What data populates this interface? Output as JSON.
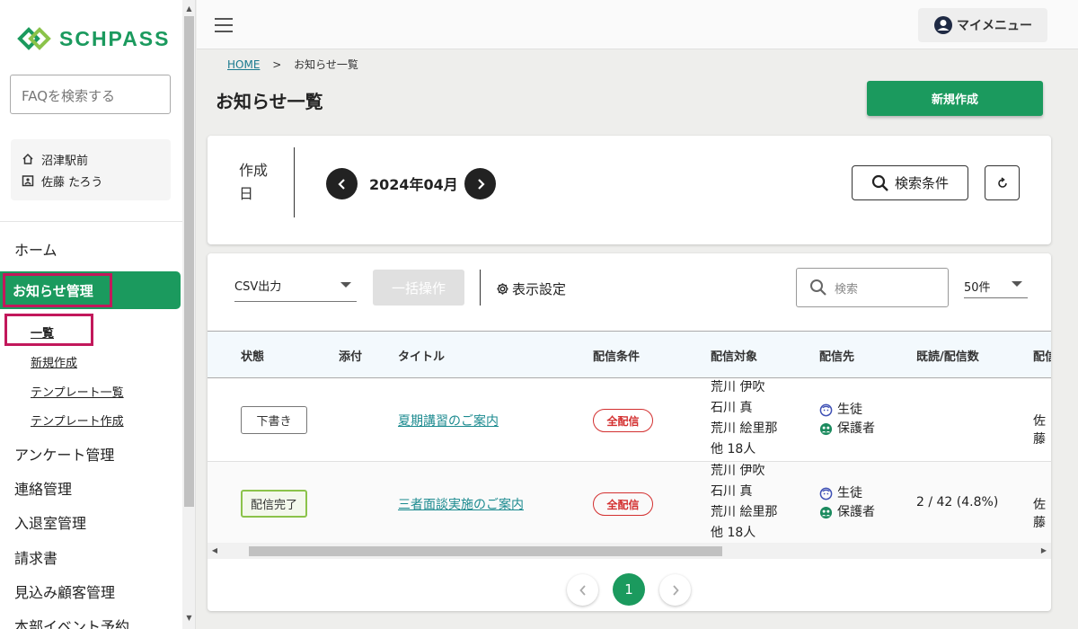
{
  "brand": {
    "name": "SCHPASS",
    "color": "#1b9a5e"
  },
  "sidebar": {
    "faq_placeholder": "FAQを検索する",
    "school": "沼津駅前",
    "user": "佐藤 たろう",
    "home": "ホーム",
    "active_section": "お知らせ管理",
    "sub_items": [
      "一覧",
      "新規作成",
      "テンプレート一覧",
      "テンプレート作成"
    ],
    "items": [
      "アンケート管理",
      "連絡管理",
      "入退室管理",
      "請求書",
      "見込み顧客管理",
      "本部イベント予約"
    ]
  },
  "topbar": {
    "my_menu": "マイメニュー"
  },
  "breadcrumb": {
    "home": "HOME",
    "sep": ">",
    "current": "お知らせ一覧"
  },
  "page": {
    "title": "お知らせ一覧",
    "new_button": "新規作成"
  },
  "date_filter": {
    "label": "作成日",
    "month": "2024年04月",
    "search_conditions": "検索条件"
  },
  "toolbar": {
    "csv_label": "CSV出力",
    "bulk_label": "一括操作",
    "display_settings": "表示設定",
    "search_placeholder": "検索",
    "per_page": "50件"
  },
  "table": {
    "columns": [
      "状態",
      "添付",
      "タイトル",
      "配信条件",
      "配信対象",
      "配信先",
      "既読/配信数",
      "配信者"
    ],
    "rows": [
      {
        "status": "下書き",
        "title": "夏期講習のご案内",
        "condition": "全配信",
        "targets": [
          "荒川 伊吹",
          "石川 真",
          "荒川 絵里那",
          "他  18人"
        ],
        "dest": [
          "生徒",
          "保護者"
        ],
        "read": "",
        "sender": "佐藤"
      },
      {
        "status": "配信完了",
        "title": "三者面談実施のご案内",
        "condition": "全配信",
        "targets": [
          "荒川 伊吹",
          "石川 真",
          "荒川 絵里那",
          "他  18人"
        ],
        "dest": [
          "生徒",
          "保護者"
        ],
        "read": "2 / 42 (4.8%)",
        "sender": "佐藤"
      }
    ]
  },
  "pagination": {
    "current": "1"
  }
}
